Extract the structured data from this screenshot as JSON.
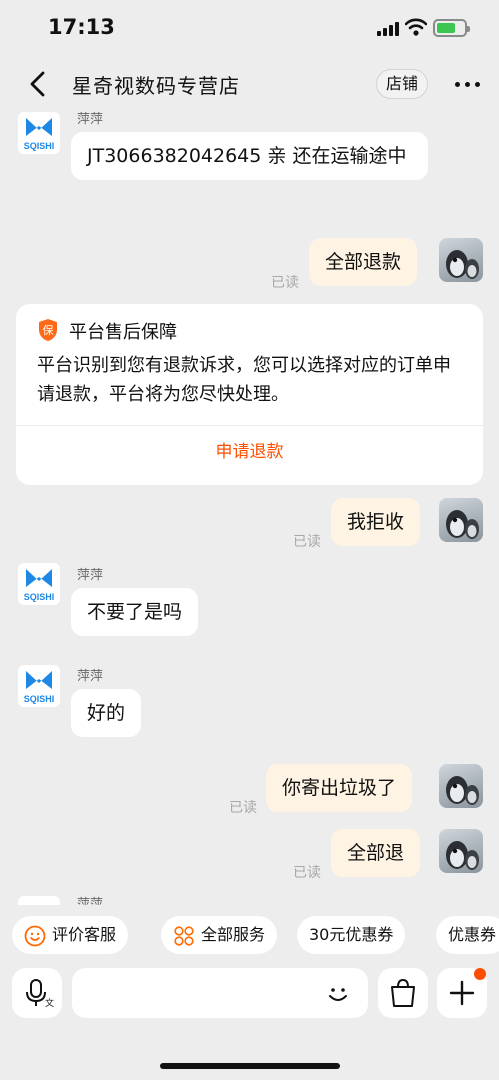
{
  "status_bar": {
    "time": "17:13"
  },
  "nav": {
    "title": "星奇视数码专营店",
    "store_button": "店铺"
  },
  "messages": {
    "m1": {
      "sender": "萍萍",
      "text": "JT3066382042645   亲 还在运输途中"
    },
    "m2": {
      "text": "全部退款",
      "read": "已读"
    },
    "card": {
      "title": "平台售后保障",
      "body": "平台识别到您有退款诉求，您可以选择对应的订单申请退款，平台将为您尽快处理。",
      "link": "申请退款",
      "shield_glyph": "保"
    },
    "m3": {
      "text": "我拒收",
      "read": "已读"
    },
    "m4": {
      "sender": "萍萍",
      "text": "不要了是吗"
    },
    "m5": {
      "sender": "萍萍",
      "text": "好的"
    },
    "m6": {
      "text": "你寄出垃圾了",
      "read": "已读"
    },
    "m7": {
      "text": "全部退",
      "read": "已读"
    },
    "m8": {
      "sender": "萍萍"
    }
  },
  "shop_logo_text": "SQISHI",
  "quick_actions": [
    "评价客服",
    "全部服务",
    "30元优惠券",
    "优惠券"
  ],
  "input": {
    "placeholder": ""
  },
  "colors": {
    "accent": "#ff5000",
    "user_bubble": "#fff4e4",
    "logo_blue": "#1e88e5"
  }
}
